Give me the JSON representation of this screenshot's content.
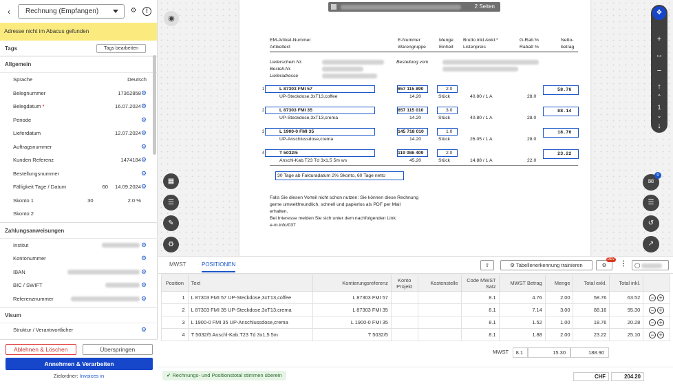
{
  "left": {
    "doc_type": "Rechnung (Empfangen)",
    "banner": "Adresse nicht im Abacus gefunden",
    "tags_label": "Tags",
    "tags_button": "Tags bearbeiten",
    "allgemein_label": "Allgemein",
    "fields": [
      {
        "label": "Sprache",
        "value": "Deutsch"
      },
      {
        "label": "Belegnummer",
        "value": "17362858"
      },
      {
        "label": "Belegdatum",
        "value": "16.07.2024",
        "required": "*"
      },
      {
        "label": "Periode",
        "value": ""
      },
      {
        "label": "Lieferdatum",
        "value": "12.07.2024"
      },
      {
        "label": "Auftragsnummer",
        "value": ""
      },
      {
        "label": "Kunden Referenz",
        "value": "1474184"
      },
      {
        "label": "Bestellungsnummer",
        "value": ""
      },
      {
        "label": "Fälligkeit Tage / Datum",
        "value_a": "60",
        "value": "14.09.2024"
      },
      {
        "label": "Skonto 1",
        "value_a": "30",
        "value": "2.0 %"
      },
      {
        "label": "Skonto 2",
        "value": ""
      }
    ],
    "zahlung_label": "Zahlungsanweisungen",
    "zahlung_fields": [
      {
        "label": "Institut"
      },
      {
        "label": "Kontonummer"
      },
      {
        "label": "IBAN"
      },
      {
        "label": "BIC / SWIFT"
      },
      {
        "label": "Referenznummer"
      }
    ],
    "visum_label": "Visum",
    "visum_field": "Struktur / Verantwortlicher",
    "btn_reject": "Ablehnen & Löschen",
    "btn_skip": "Überspringen",
    "btn_accept": "Annehmen & Verarbeiten",
    "target_label": "Zielordner:",
    "target_value": "Invoices in"
  },
  "viewer": {
    "page_count": "2 Seiten",
    "chat_badge": "0",
    "zoom_page": "1",
    "doc": {
      "h1": "EM-Artikel-Nummer",
      "h1b": "Artikeltext",
      "h2": "E-Nummer",
      "h2b": "Warengruppe",
      "h3": "Menge",
      "h3b": "Einheit",
      "h4": "Brutto inkl./exkl.*",
      "h4b": "Listenpreis",
      "h5": "G-Rab.%",
      "h5b": "Rabatt %",
      "h6": "Netto-",
      "h6b": "betrag",
      "ls": "Lieferschein Nr.",
      "bn": "Bestell-Nr.",
      "la": "Lieferadresse",
      "bv": "Bestellung vom",
      "items": [
        {
          "no": "1",
          "art": "L 87303 FMI 57",
          "text": "UP-Steckdose,3xT13,coffee",
          "enr": "657 115 890",
          "wg": "14.20",
          "menge": "2.0",
          "einh": "Stück",
          "list": "40.80  /  1   A",
          "rab": "28.0",
          "netto": "58.76"
        },
        {
          "no": "2",
          "art": "L 87303 FMI 35",
          "text": "UP-Steckdose,3xT13,crema",
          "enr": "657 115 010",
          "wg": "14.20",
          "menge": "3.0",
          "einh": "Stück",
          "list": "40.80  /  1   A",
          "rab": "28.0",
          "netto": "88.14"
        },
        {
          "no": "3",
          "art": "L 1900-0 FMI 35",
          "text": "UP-Anschlussdose,crema",
          "enr": "145 718 010",
          "wg": "14.20",
          "menge": "1.0",
          "einh": "Stück",
          "list": "26.05  /  1   A",
          "rab": "28.0",
          "netto": "18.76"
        },
        {
          "no": "4",
          "art": "T 5032/5",
          "text": "Anschl-Kab.T23 Td 3x1,5 5m ws",
          "enr": "119 086 409",
          "wg": "45.20",
          "menge": "2.0",
          "einh": "Stück",
          "list": "14.88  /  1   A",
          "rab": "22.0",
          "netto": "23.22"
        }
      ],
      "terms": "30 Tage ab Fakturadatum 2% Skonto, 60 Tage netto",
      "note1": "Falls Sie diesen Vorteil nicht schon nutzen: Sie können diese Rechnung",
      "note2": "gerne umweltfreundlich, schnell und papierlos als PDF per Mail",
      "note3": "erhalten.",
      "note4": "Bei Interesse melden Sie sich unter dem nachfolgenden Link:",
      "note5": "e-m.info/037"
    }
  },
  "bottom": {
    "tab_mwst": "MWST",
    "tab_pos": "POSITIONEN",
    "btn_train": "Tabellenerkennung trainieren",
    "dev": "DEV",
    "cols": [
      "Position",
      "Text",
      "Kontierungsreferenz",
      "Konto Projekt",
      "Kostenstelle",
      "Code MWST Satz",
      "MWST Betrag",
      "Menge",
      "Total exkl.",
      "Total inkl."
    ],
    "rows": [
      {
        "pos": "1",
        "text": "L 87303 FMI 57 UP-Steckdose,3xT13,coffee",
        "ref": "L 87303 FMI 57",
        "mwst_satz": "8.1",
        "mwst_betrag": "4.76",
        "menge": "2.00",
        "exkl": "58.76",
        "inkl": "63.52"
      },
      {
        "pos": "2",
        "text": "L 87303 FMI 35 UP-Steckdose,3xT13,crema",
        "ref": "L 87303 FMI 35",
        "mwst_satz": "8.1",
        "mwst_betrag": "7.14",
        "menge": "3.00",
        "exkl": "88.16",
        "inkl": "95.30"
      },
      {
        "pos": "3",
        "text": "L 1900-0 FMI 35 UP-Anschlussdose,crema",
        "ref": "L 1900-0 FMI 35",
        "mwst_satz": "8.1",
        "mwst_betrag": "1.52",
        "menge": "1.00",
        "exkl": "18.76",
        "inkl": "20.28"
      },
      {
        "pos": "4",
        "text": "T 5032/5 Anschl-Kab.T23 Td 3x1,5 5m",
        "ref": "T 5032/5",
        "mwst_satz": "8.1",
        "mwst_betrag": "1.88",
        "menge": "2.00",
        "exkl": "23.22",
        "inkl": "25.10"
      }
    ],
    "mwst_label": "MWST",
    "mwst_rate": "8.1",
    "mwst_amount": "15.30",
    "net_total": "188.90",
    "status": "Rechnungs- und Positionstotal stimmen überein",
    "currency": "CHF",
    "grand_total": "204.20"
  }
}
